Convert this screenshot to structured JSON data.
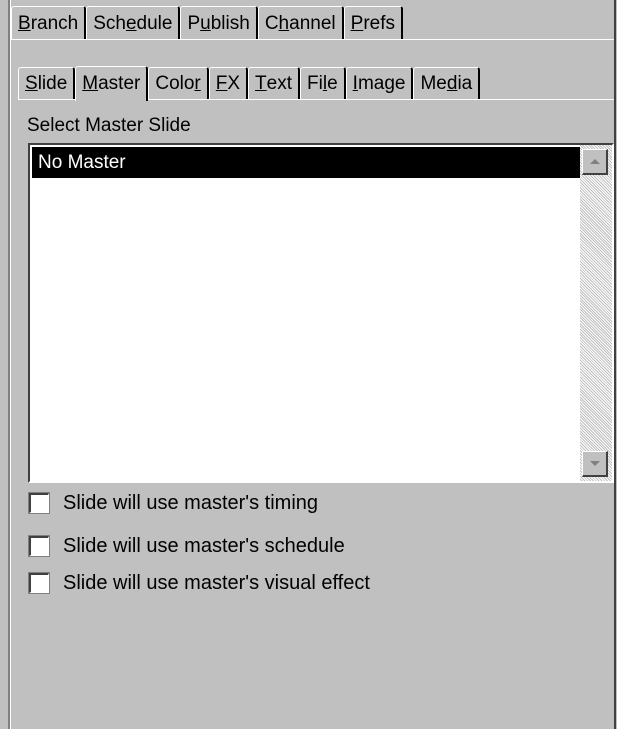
{
  "tabs_primary": [
    {
      "label": "Branch",
      "mnemonic_index": 0
    },
    {
      "label": "Schedule",
      "mnemonic_index": 3
    },
    {
      "label": "Publish",
      "mnemonic_index": 1
    },
    {
      "label": "Channel",
      "mnemonic_index": 1
    },
    {
      "label": "Prefs",
      "mnemonic_index": 0
    }
  ],
  "tabs_secondary": [
    {
      "label": "Slide",
      "mnemonic_index": 0,
      "active": false
    },
    {
      "label": "Master",
      "mnemonic_index": 0,
      "active": true
    },
    {
      "label": "Color",
      "mnemonic_index": 4,
      "active": false
    },
    {
      "label": "FX",
      "mnemonic_index": 0,
      "active": false
    },
    {
      "label": "Text",
      "mnemonic_index": 0,
      "active": false
    },
    {
      "label": "File",
      "mnemonic_index": 2,
      "active": false
    },
    {
      "label": "Image",
      "mnemonic_index": 0,
      "active": false
    },
    {
      "label": "Media",
      "mnemonic_index": 2,
      "active": false
    }
  ],
  "master_select": {
    "label": "Select Master Slide",
    "items": [
      "No Master"
    ],
    "selected_index": 0
  },
  "options": [
    {
      "label": "Slide will use master's timing",
      "checked": false
    },
    {
      "label": "Slide will use master's schedule",
      "checked": false
    },
    {
      "label": "Slide will use master's visual effect",
      "checked": false
    }
  ]
}
